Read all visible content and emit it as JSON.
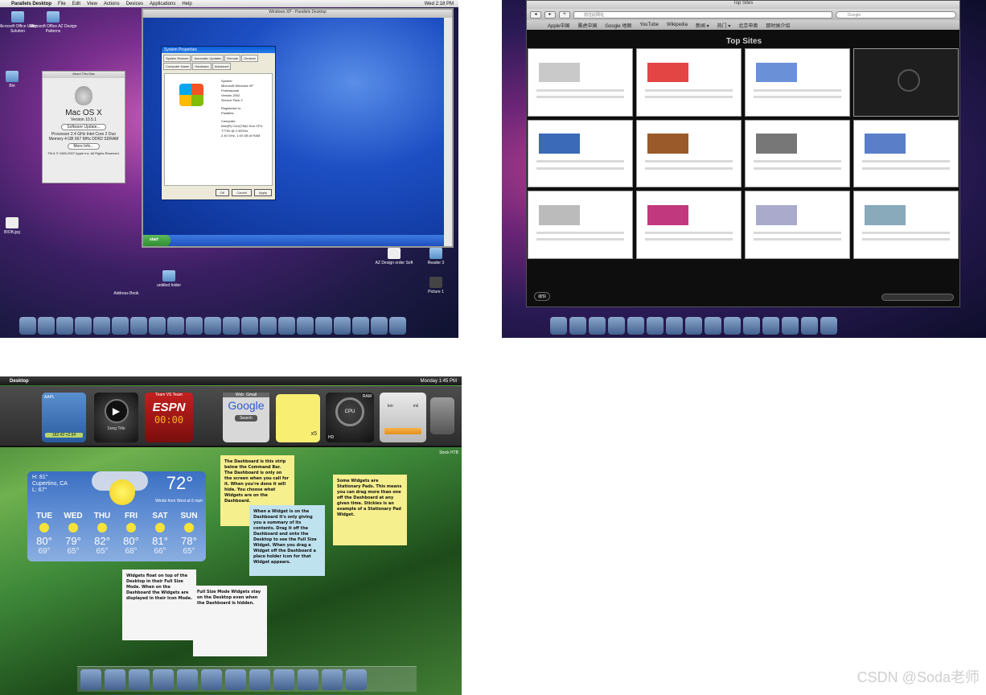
{
  "panel1": {
    "menubar": {
      "app": "Parallels Desktop",
      "items": [
        "File",
        "Edit",
        "View",
        "Actions",
        "Devices",
        "Applications",
        "Help"
      ],
      "clock": "Wed 2:18 PM"
    },
    "desktop_icons": [
      {
        "label": "Microsoft Office Utility Solution"
      },
      {
        "label": "Microsoft Office AZ Design Patterns"
      },
      {
        "label": "Bin"
      },
      {
        "label": "BIOB.jpg"
      },
      {
        "label": "AZ Design order Soft"
      },
      {
        "label": "Reader 3"
      },
      {
        "label": "Address Book"
      },
      {
        "label": "untitled folder"
      },
      {
        "label": "Picture 1"
      }
    ],
    "about_mac": {
      "title": "About This Mac",
      "os": "Mac OS X",
      "version": "Version 10.5.1",
      "update_button": "Software Update...",
      "processor": "Processor  2.4 GHz Intel Core 2 Duo",
      "memory": "Memory  4 GB 667 MHz DDR2 SDRAM",
      "more_button": "More Info...",
      "footer": "TM & © 1983-2007 Apple Inc. All Rights Reserved."
    },
    "xp_window": {
      "title": "Windows XP - Parallels Desktop",
      "start_label": "start",
      "sys_props": {
        "title": "System Properties",
        "tabs": [
          "System Restore",
          "Automatic Updates",
          "Remote",
          "General",
          "Computer Name",
          "Hardware",
          "Advanced"
        ],
        "system_heading": "System:",
        "system_lines": [
          "Microsoft Windows XP",
          "Professional",
          "Version 2002",
          "Service Pack 2"
        ],
        "registered_heading": "Registered to:",
        "registered_name": "Parallels",
        "computer_heading": "Computer:",
        "computer_lines": [
          "Intel(R) Core(TM)2 Duo CPU",
          "T7700 @ 2.40GHz",
          "2.40 GHz, 1.00 GB of RAM"
        ],
        "ok": "OK",
        "cancel": "Cancel",
        "apply": "Apply"
      }
    }
  },
  "panel2": {
    "window_title": "Top Sites",
    "url_placeholder": "前往此网址",
    "search_placeholder": "Google",
    "bookmarks": [
      "Apple中国",
      "雅虎中国",
      "Google 地图",
      "YouTube",
      "Wikipedia",
      "新闻 ▾",
      "热门 ▾",
      "北京申奥",
      "那时候介绍"
    ],
    "heading": "Top Sites",
    "edit_button": "编辑",
    "tile_count_note": ""
  },
  "panel3": {
    "menubar": {
      "app": "Desktop",
      "clock": "Monday 1:45 PM"
    },
    "stocks": {
      "symbol": "AAPL",
      "value": "182.42 +2.94"
    },
    "itunes": {
      "label": "Song Title"
    },
    "espn": {
      "label": "Team VS Team",
      "logo": "ESPN",
      "score": "00:00"
    },
    "google": {
      "tab_web": "Web",
      "tab_gmail": "Gmail",
      "logo": "Google",
      "button": "Search"
    },
    "sticky": {
      "text": "x5"
    },
    "cpu": {
      "label": "CPU",
      "ram": "RAM",
      "hd": "HD"
    },
    "units": {
      "left": "km",
      "right": "mil"
    },
    "corner_label": "Stock HTB",
    "weather": {
      "hi": "H: 81°",
      "city": "Cupertino, CA",
      "lo": "L: 67°",
      "temp": "72°",
      "wind": "Winds from West at 6 mph",
      "days": [
        {
          "name": "TUE",
          "hi": "80°",
          "lo": "69°"
        },
        {
          "name": "WED",
          "hi": "79°",
          "lo": "65°"
        },
        {
          "name": "THU",
          "hi": "82°",
          "lo": "65°"
        },
        {
          "name": "FRI",
          "hi": "80°",
          "lo": "68°"
        },
        {
          "name": "SAT",
          "hi": "81°",
          "lo": "66°"
        },
        {
          "name": "SUN",
          "hi": "78°",
          "lo": "65°"
        }
      ]
    },
    "notes": [
      {
        "text": "The Dashboard is this strip below the Command Bar. The Dashboard is only on the screen when you call for it. When you're done it will hide. You choose what Widgets are on the Dashboard."
      },
      {
        "text": "When a Widget is on the Dashboard it's only giving you a summary of its contents. Drag it off the Dashboard and onto the Desktop to see the Full Size Widget. When you drag a Widget off the Dashboard a place holder icon for that Widget appears."
      },
      {
        "text": "Some Widgets are Stationary Pads. This means you can drag more than one off the Dashboard at any given time. Stickies is an example of a Stationary Pad Widget."
      },
      {
        "text": "Widgets float on top of the Desktop in their Full Size Mode. When on the Dashboard the Widgets are displayed in their Icon Mode."
      },
      {
        "text": "Full Size Mode Widgets stay on the Desktop even when the Dashboard is hidden."
      }
    ]
  },
  "watermark": "CSDN @Soda老师"
}
